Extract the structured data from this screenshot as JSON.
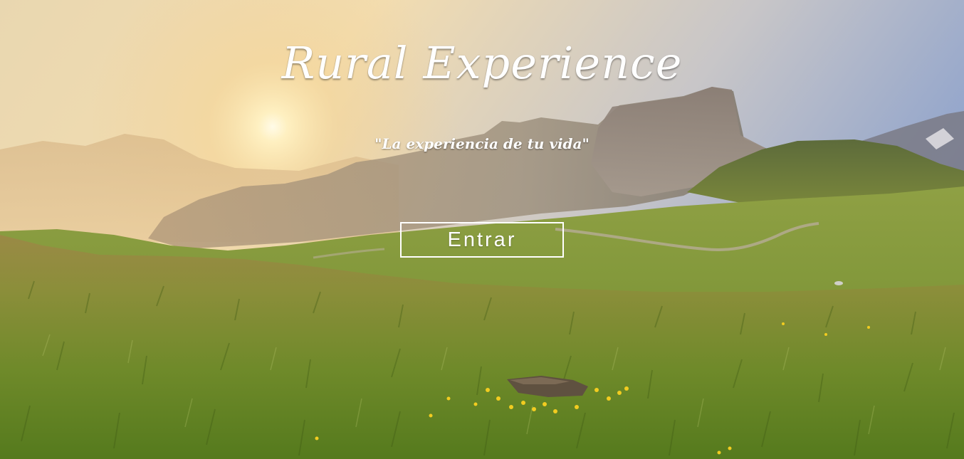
{
  "hero": {
    "title": "Rural Experience",
    "tagline": "\"La experiencia de tu vida\"",
    "enter_label": "Entrar",
    "background": "mountain-meadow-sunrise-photo"
  },
  "colors": {
    "text": "#ffffff",
    "button_border": "#ffffff",
    "sky_top": "#9fb0cf",
    "sky_glow": "#f4d9a4",
    "grass": "#6f8a2a"
  }
}
